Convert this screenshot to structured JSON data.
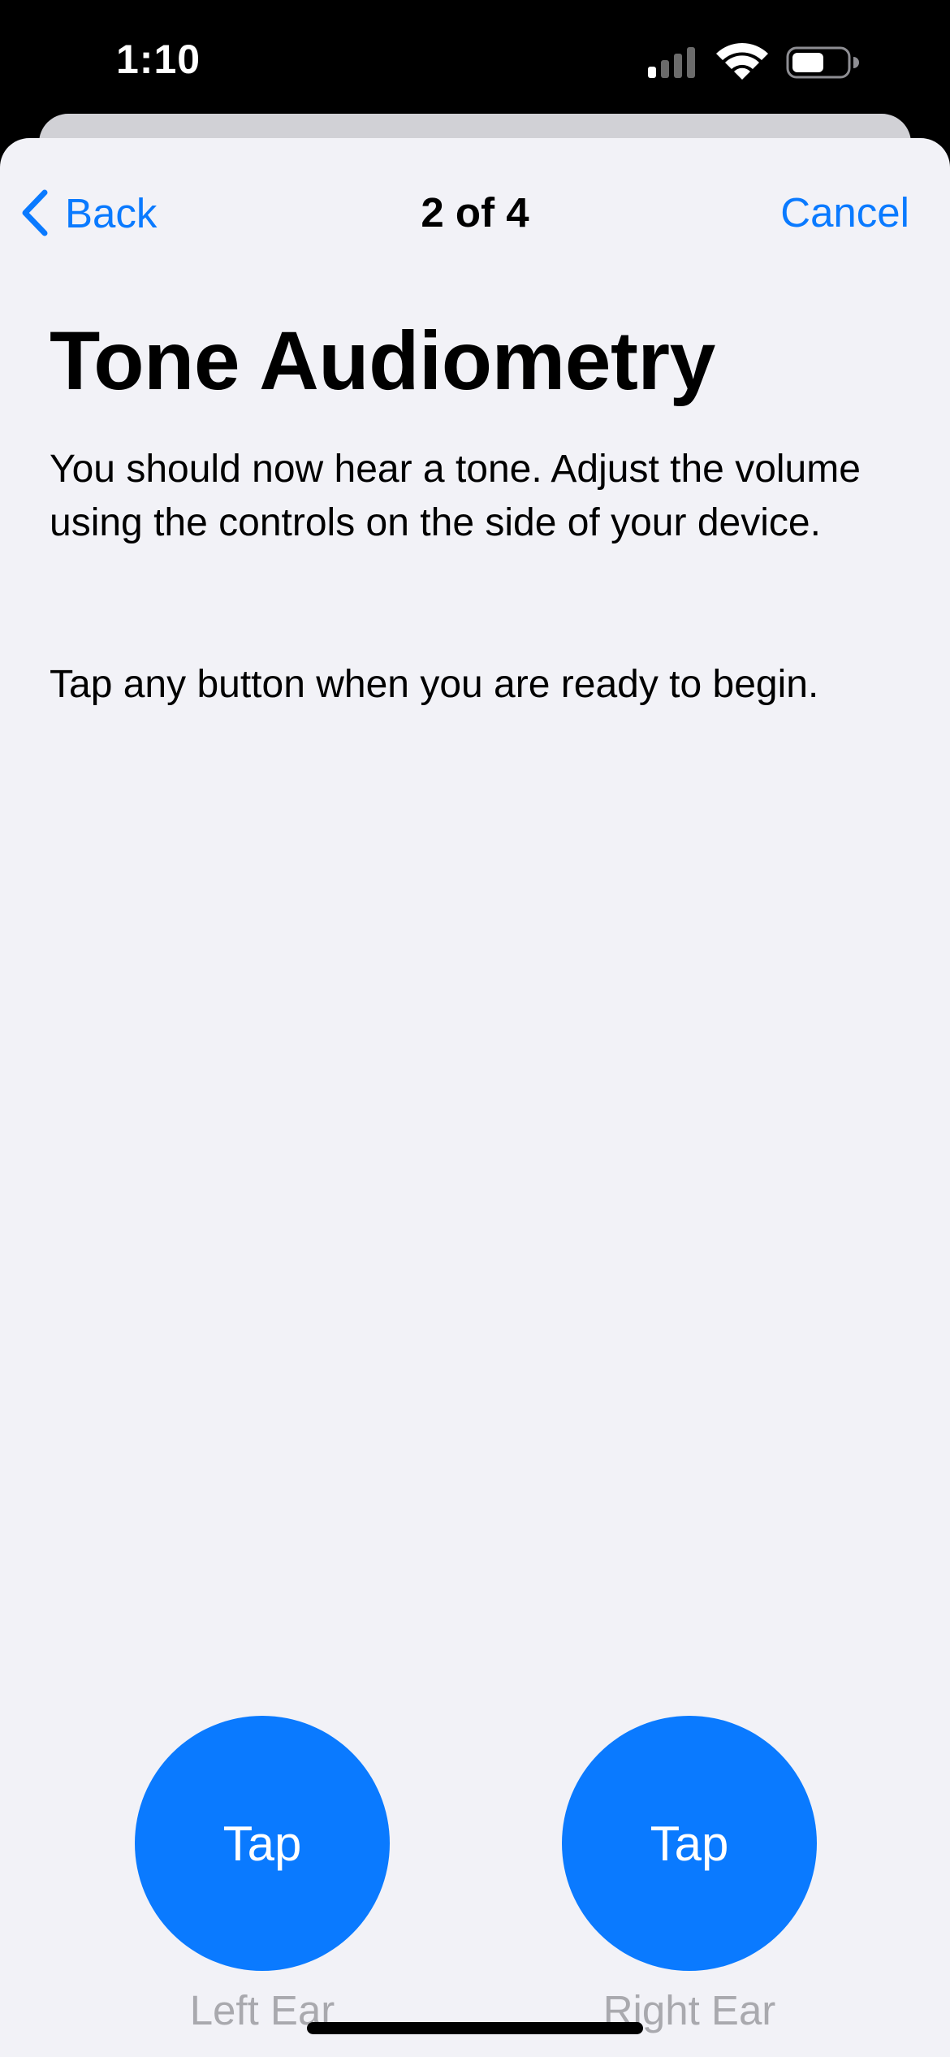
{
  "status_bar": {
    "time": "1:10",
    "icons": [
      "cellular-signal-icon",
      "wifi-icon",
      "battery-icon"
    ]
  },
  "nav": {
    "back_label": "Back",
    "title": "2 of 4",
    "cancel_label": "Cancel"
  },
  "content": {
    "title": "Tone Audiometry",
    "instruction": "You should now hear a tone. Adjust the volume using the controls on the side of your device.",
    "prompt": "Tap any button when you are ready to begin."
  },
  "buttons": [
    {
      "label": "Tap",
      "caption": "Left Ear"
    },
    {
      "label": "Tap",
      "caption": "Right Ear"
    }
  ],
  "colors": {
    "accent": "#0a7aff",
    "background": "#f2f2f7",
    "caption": "#a9a9ae",
    "status_bar": "#000000"
  }
}
